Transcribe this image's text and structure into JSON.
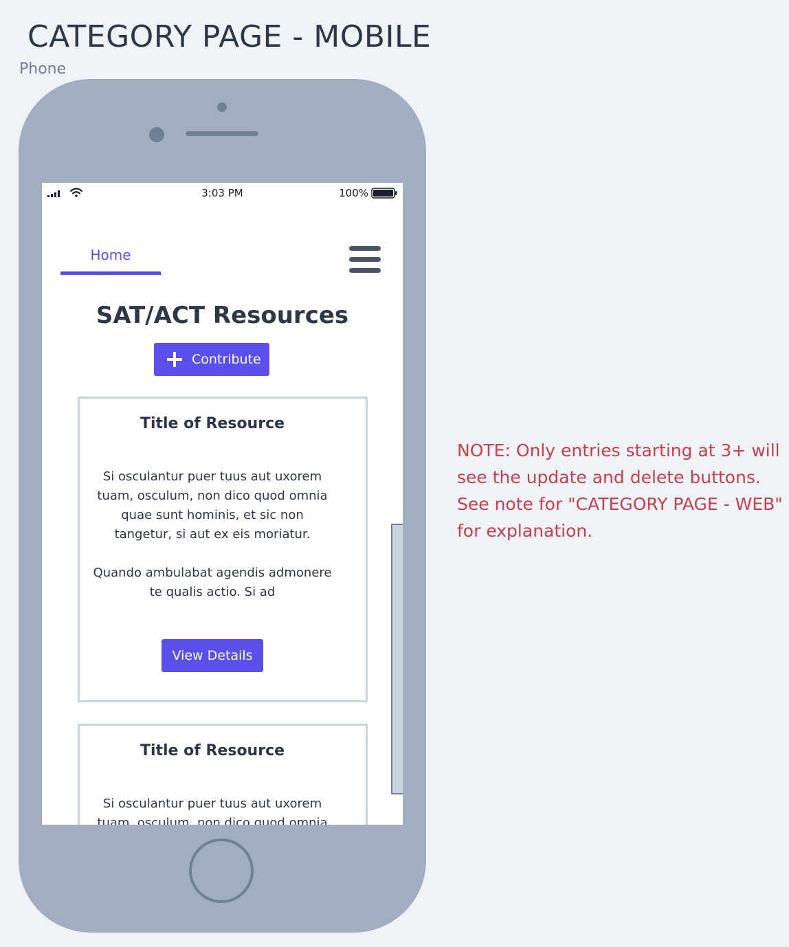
{
  "header": {
    "title": "CATEGORY PAGE - MOBILE",
    "frame_label": "Phone"
  },
  "status_bar": {
    "time": "3:03 PM",
    "battery": "100%"
  },
  "nav": {
    "home_label": "Home"
  },
  "page": {
    "title": "SAT/ACT Resources",
    "contribute_label": "Contribute"
  },
  "cards": [
    {
      "title": "Title of Resource",
      "body_paragraphs": [
        "Si osculantur puer tuus aut uxorem tuam, osculum, non dico quod omnia quae sunt hominis, et sic non tangetur, si aut ex eis moriatur.",
        "Quando ambulabat agendis admonere te qualis actio. Si ad"
      ],
      "button_label": "View Details"
    },
    {
      "title": "Title of Resource",
      "body_paragraphs": [
        "Si osculantur puer tuus aut uxorem tuam, osculum, non dico quod omnia"
      ]
    }
  ],
  "note": "NOTE: Only entries starting at 3+ will see the update and delete buttons. See note for \"CATEGORY PAGE - WEB\" for explanation.",
  "colors": {
    "accent": "#5a4fe8",
    "note": "#c53f4f",
    "phone_body": "#a0aec0"
  }
}
